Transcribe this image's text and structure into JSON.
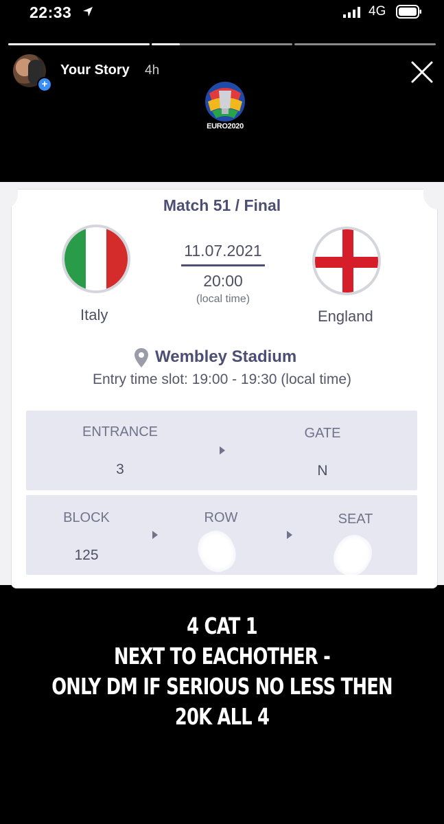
{
  "status_bar": {
    "time": "22:33",
    "network": "4G"
  },
  "story": {
    "progress_segments": [
      1.0,
      0.2,
      0.0
    ],
    "name": "Your Story",
    "age": "4h"
  },
  "logo": {
    "text": "EURO2020"
  },
  "ticket": {
    "match": "Match 51 / Final",
    "home_team": "Italy",
    "away_team": "England",
    "date": "11.07.2021",
    "kickoff": "20:00",
    "local_note": "(local time)",
    "venue": "Wembley Stadium",
    "entry_slot": "Entry time slot: 19:00 - 19:30 (local time)",
    "entrance_label": "ENTRANCE",
    "entrance_value": "3",
    "gate_label": "GATE",
    "gate_value": "N",
    "block_label": "BLOCK",
    "block_value": "125",
    "row_label": "ROW",
    "seat_label": "SEAT"
  },
  "caption": {
    "line1": "4 CAT 1",
    "line2": "NEXT TO EACHOTHER -",
    "line3": "ONLY DM IF SERIOUS NO LESS THEN",
    "line4": "20K ALL 4"
  },
  "colors": {
    "ticket_text": "#4c4f73",
    "info_box": "#e6e7f1",
    "italy_green": "#2a9b48",
    "italy_red": "#d42b2b",
    "england_red": "#d61d2a"
  }
}
